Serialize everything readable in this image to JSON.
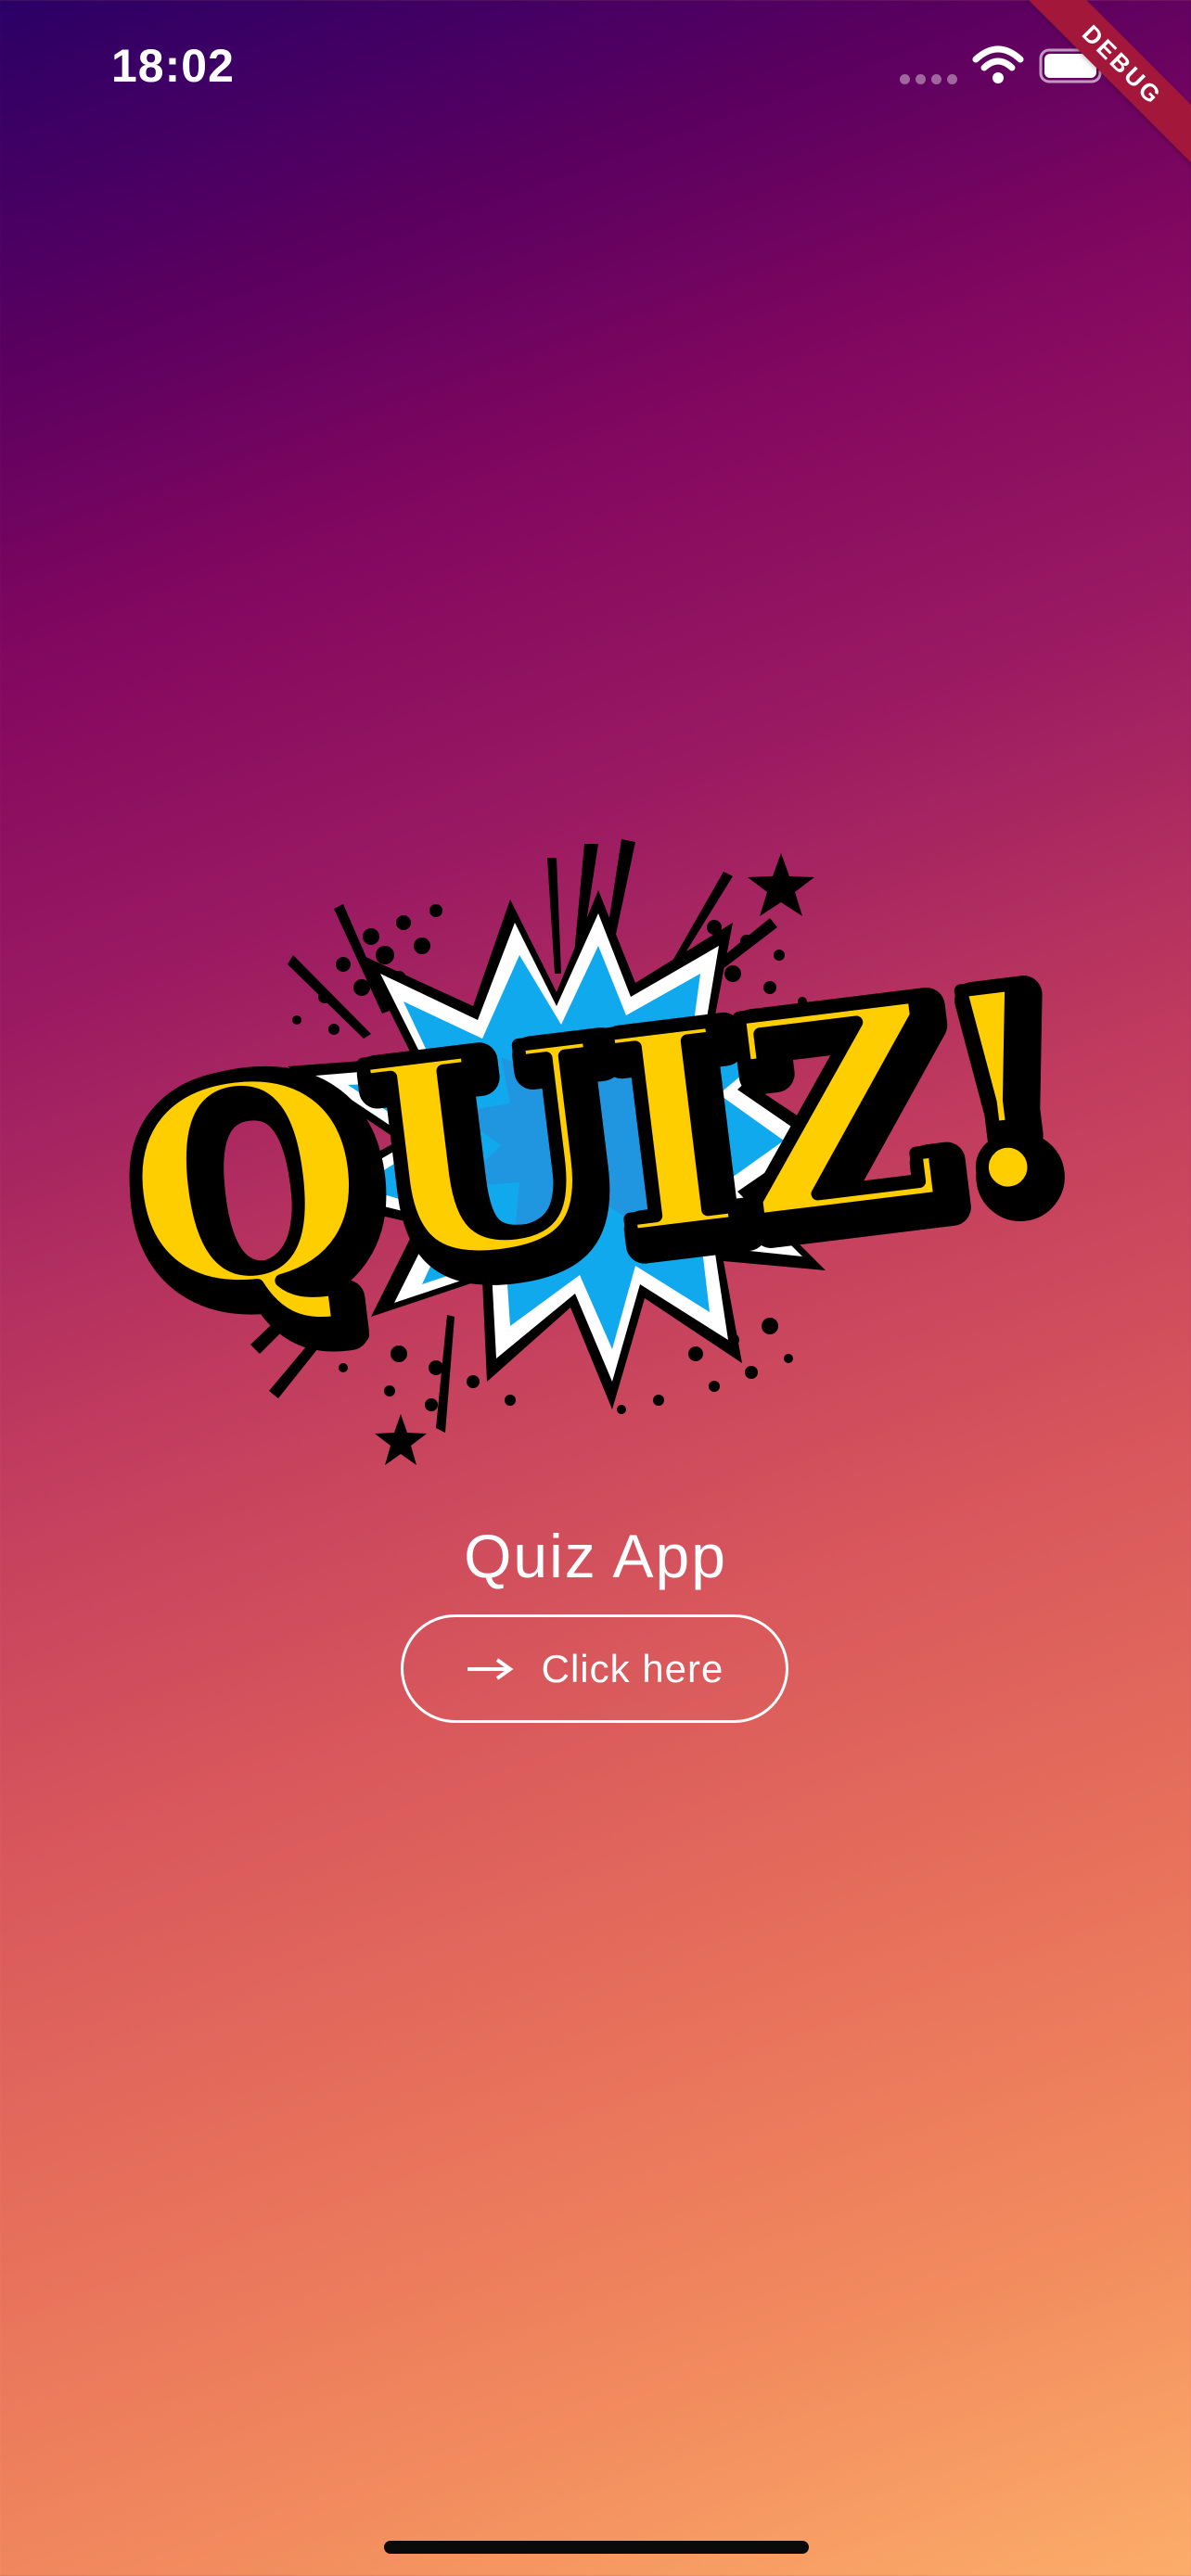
{
  "status_bar": {
    "time": "18:02",
    "icons": [
      "signal-dots-icon",
      "wifi-icon",
      "battery-icon"
    ]
  },
  "debug_banner": "DEBUG",
  "logo": {
    "text": "QUIZ!",
    "colors": {
      "letters": "#FFCE00",
      "burst": "#10A9EE",
      "outline": "#000000"
    }
  },
  "main": {
    "title": "Quiz App",
    "button": {
      "label": "Click here",
      "icon": "arrow-right-icon"
    }
  },
  "theme": {
    "gradient_start": "#2A0066",
    "gradient_mid": "#82075F",
    "gradient_end": "#FCAD6A"
  }
}
